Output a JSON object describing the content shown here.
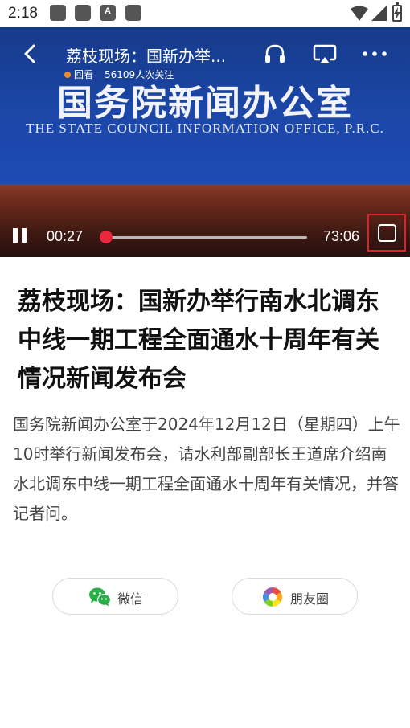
{
  "status_bar": {
    "time": "2:18",
    "notification_icons": [
      "app-icon",
      "app-icon",
      "a-icon",
      "app-icon"
    ],
    "notification_letter": "A",
    "system_icons": [
      "wifi-icon",
      "signal-icon",
      "battery-charging-icon"
    ]
  },
  "player": {
    "title": "荔枝现场：国新办举...",
    "live_status": "回看",
    "view_count": "56109人次关注",
    "backdrop_sign": "国务院新闻办公室",
    "backdrop_sign_en": "THE STATE COUNCIL INFORMATION OFFICE, P.R.C.",
    "current_time": "00:27",
    "total_time": "73:06",
    "progress_fraction": 0.006,
    "accent_color": "#e8283c",
    "highlight_color": "#e0202a"
  },
  "article": {
    "title": "荔枝现场：国新办举行南水北调东中线一期工程全面通水十周年有关情况新闻发布会",
    "body": "国务院新闻办公室于2024年12月12日（星期四）上午10时举行新闻发布会，请水利部副部长王道席介绍南水北调东中线一期工程全面通水十周年有关情况，并答记者问。"
  },
  "share": {
    "wechat_label": "微信",
    "moments_label": "朋友圈",
    "wechat_color": "#2aae48"
  }
}
